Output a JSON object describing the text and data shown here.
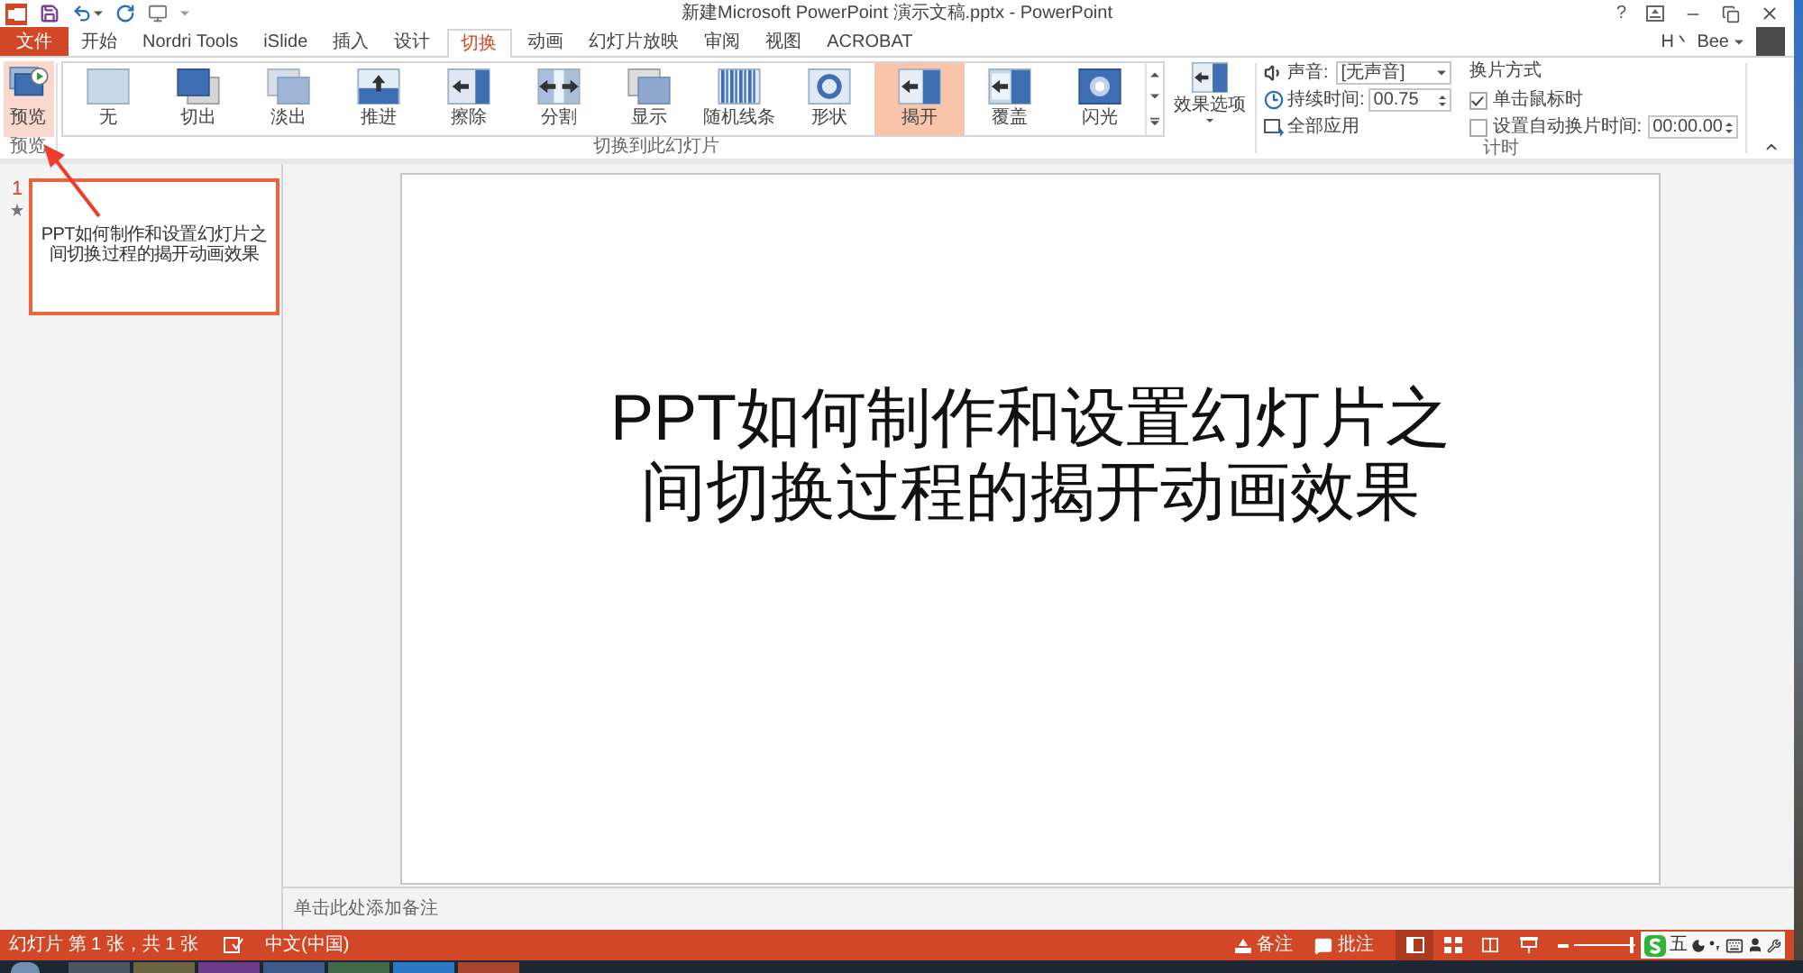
{
  "title_bar": {
    "title": "新建Microsoft PowerPoint 演示文稿.pptx - PowerPoint",
    "help": "?"
  },
  "ribbon_tabs": [
    {
      "label": "文件",
      "kind": "file",
      "selected": false
    },
    {
      "label": "开始",
      "kind": "tab",
      "selected": false
    },
    {
      "label": "Nordri Tools",
      "kind": "tab",
      "selected": false
    },
    {
      "label": "iSlide",
      "kind": "tab",
      "selected": false
    },
    {
      "label": "插入",
      "kind": "tab",
      "selected": false
    },
    {
      "label": "设计",
      "kind": "tab",
      "selected": false
    },
    {
      "label": "切换",
      "kind": "tab",
      "selected": true
    },
    {
      "label": "动画",
      "kind": "tab",
      "selected": false
    },
    {
      "label": "幻灯片放映",
      "kind": "tab",
      "selected": false
    },
    {
      "label": "审阅",
      "kind": "tab",
      "selected": false
    },
    {
      "label": "视图",
      "kind": "tab",
      "selected": false
    },
    {
      "label": "ACROBAT",
      "kind": "tab",
      "selected": false
    }
  ],
  "account": {
    "name": "H丶 Bee"
  },
  "preview_group": {
    "button": "预览",
    "highlighted": true,
    "label": "预览"
  },
  "transitions_group": {
    "label": "切换到此幻灯片",
    "effects": [
      {
        "label": "无",
        "kind": "none",
        "selected": false
      },
      {
        "label": "切出",
        "kind": "cut",
        "selected": false
      },
      {
        "label": "淡出",
        "kind": "fade",
        "selected": false
      },
      {
        "label": "推进",
        "kind": "push",
        "selected": false
      },
      {
        "label": "擦除",
        "kind": "wipe",
        "selected": false
      },
      {
        "label": "分割",
        "kind": "split",
        "selected": false
      },
      {
        "label": "显示",
        "kind": "reveal",
        "selected": false
      },
      {
        "label": "随机线条",
        "kind": "random-bars",
        "selected": false
      },
      {
        "label": "形状",
        "kind": "shape",
        "selected": false
      },
      {
        "label": "揭开",
        "kind": "uncover",
        "selected": true
      },
      {
        "label": "覆盖",
        "kind": "cover",
        "selected": false
      },
      {
        "label": "闪光",
        "kind": "flash",
        "selected": false
      }
    ],
    "effect_options": "效果选项"
  },
  "timing_group": {
    "label": "计时",
    "sound": {
      "label": "声音:",
      "value": "[无声音]"
    },
    "duration": {
      "label": "持续时间:",
      "value": "00.75"
    },
    "apply_all": "全部应用",
    "advance_heading": "换片方式",
    "on_click": {
      "label": "单击鼠标时",
      "checked": true
    },
    "after": {
      "label": "设置自动换片时间:",
      "checked": false,
      "value": "00:00.00"
    }
  },
  "slides": [
    {
      "number": "1",
      "lines": [
        "PPT如何制作和设置幻灯片之",
        "间切换过程的揭开动画效果"
      ],
      "selected": true
    }
  ],
  "slide": {
    "lines": [
      "PPT如何制作和设置幻灯片之",
      "间切换过程的揭开动画效果"
    ]
  },
  "notes": {
    "placeholder": "单击此处添加备注"
  },
  "status_bar": {
    "slide_info": "幻灯片 第 1 张，共 1 张",
    "language": "中文(中国)",
    "notes": "备注",
    "comments": "批注",
    "views": [
      {
        "kind": "normal",
        "selected": true
      },
      {
        "kind": "sorter",
        "selected": false
      },
      {
        "kind": "reading",
        "selected": false
      },
      {
        "kind": "slideshow",
        "selected": false
      }
    ],
    "zoom": {
      "level": 0.95
    }
  },
  "ime_bar": {
    "mode": "五"
  }
}
